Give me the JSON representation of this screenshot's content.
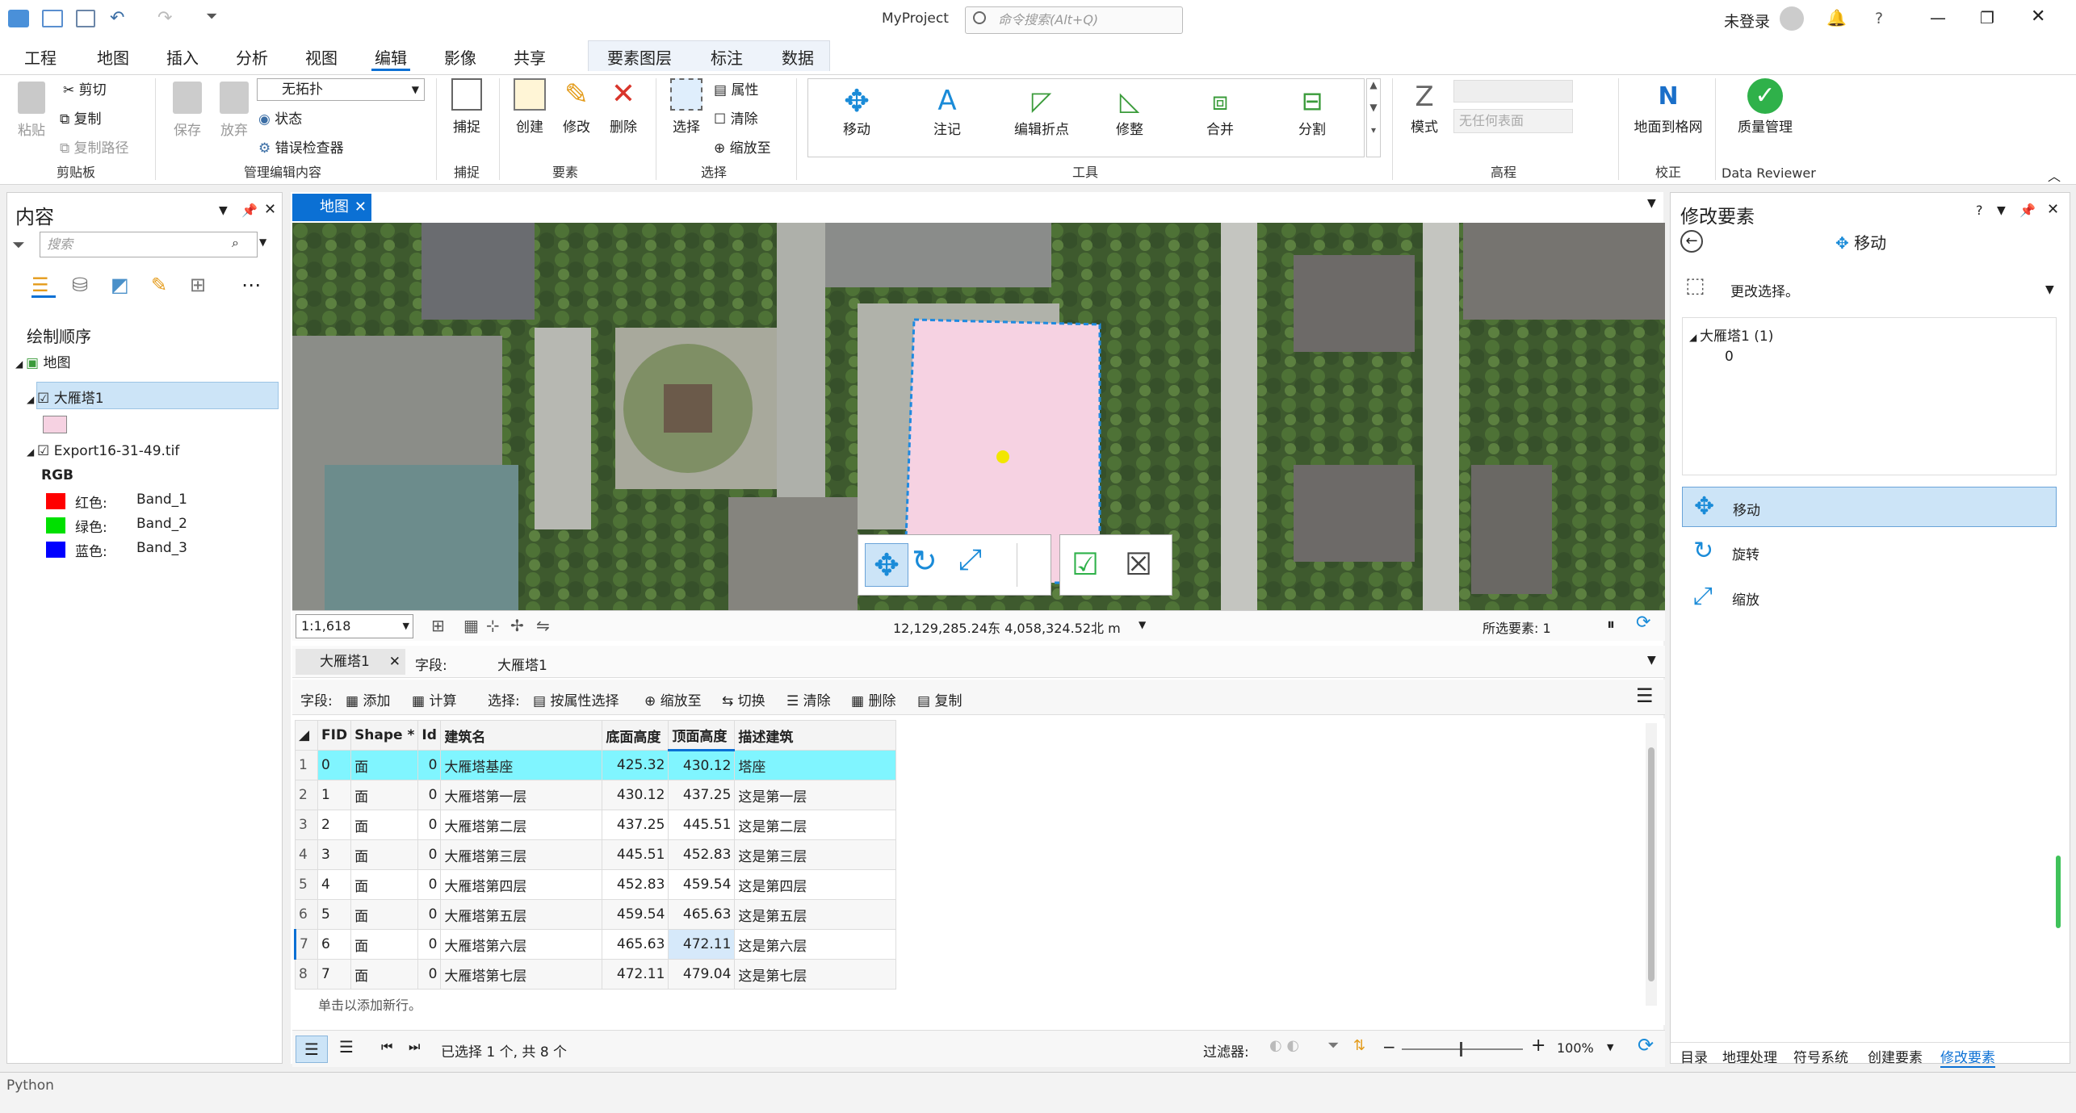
{
  "titlebar": {
    "title": "MyProject",
    "command_search_placeholder": "命令搜索(Alt+Q)",
    "sign_in": "未登录",
    "help": "?"
  },
  "tabs": [
    "工程",
    "地图",
    "插入",
    "分析",
    "视图",
    "编辑",
    "影像",
    "共享",
    "要素图层",
    "标注",
    "数据"
  ],
  "active_tab": "编辑",
  "ribbon": {
    "clipboard": {
      "paste": "粘贴",
      "cut": "剪切",
      "copy": "复制",
      "copy_path": "复制路径",
      "group": "剪贴板"
    },
    "manage": {
      "save": "保存",
      "discard": "放弃",
      "topology": "无拓扑",
      "status": "状态",
      "error_inspector": "错误检查器",
      "group": "管理编辑内容"
    },
    "snapping": {
      "snap": "捕捉",
      "group": "捕捉"
    },
    "features": {
      "create": "创建",
      "modify": "修改",
      "delete": "删除",
      "group": "要素"
    },
    "selection": {
      "select": "选择",
      "attributes": "属性",
      "clear": "清除",
      "zoom_to": "缩放至",
      "group": "选择"
    },
    "tools": {
      "move": "移动",
      "annotate": "注记",
      "edit_vertices": "编辑折点",
      "reshape": "修整",
      "merge": "合并",
      "split": "分割",
      "group": "工具"
    },
    "elevation": {
      "mode": "模式",
      "surface": "无任何表面",
      "group": "高程"
    },
    "correction": {
      "ground_to_grid": "地面到格网",
      "group": "校正"
    },
    "data_reviewer": {
      "quality": "质量管理",
      "group": "Data Reviewer"
    }
  },
  "contents": {
    "title": "内容",
    "search_placeholder": "搜索",
    "drawing_order": "绘制顺序",
    "map_name": "地图",
    "layer1": "大雁塔1",
    "layer2": "Export16-31-49.tif",
    "rgb": "RGB",
    "bands": [
      {
        "label": "红色:",
        "band": "Band_1",
        "color": "#ff0000"
      },
      {
        "label": "绿色:",
        "band": "Band_2",
        "color": "#00e000"
      },
      {
        "label": "蓝色:",
        "band": "Band_3",
        "color": "#0000ff"
      }
    ]
  },
  "map": {
    "tab_label": "地图",
    "scale": "1:1,618",
    "coords": "12,129,285.24东  4,058,324.52北 m",
    "selected_features": "所选要素: 1"
  },
  "table": {
    "tab_label": "大雁塔1",
    "fields_label": "字段:",
    "layer_name": "大雁塔1",
    "toolbar": {
      "fields": "字段:",
      "add": "添加",
      "calculate": "计算",
      "selection": "选择:",
      "select_by_attr": "按属性选择",
      "zoom_to": "缩放至",
      "switch": "切换",
      "clear": "清除",
      "delete": "删除",
      "copy": "复制"
    },
    "columns": [
      "FID",
      "Shape *",
      "Id",
      "建筑名",
      "底面高度",
      "顶面高度",
      "描述建筑"
    ],
    "rows": [
      {
        "n": "1",
        "fid": "0",
        "shape": "面",
        "id": "0",
        "name": "大雁塔基座",
        "bottom": "425.32",
        "top": "430.12",
        "desc": "塔座"
      },
      {
        "n": "2",
        "fid": "1",
        "shape": "面",
        "id": "0",
        "name": "大雁塔第一层",
        "bottom": "430.12",
        "top": "437.25",
        "desc": "这是第一层"
      },
      {
        "n": "3",
        "fid": "2",
        "shape": "面",
        "id": "0",
        "name": "大雁塔第二层",
        "bottom": "437.25",
        "top": "445.51",
        "desc": "这是第二层"
      },
      {
        "n": "4",
        "fid": "3",
        "shape": "面",
        "id": "0",
        "name": "大雁塔第三层",
        "bottom": "445.51",
        "top": "452.83",
        "desc": "这是第三层"
      },
      {
        "n": "5",
        "fid": "4",
        "shape": "面",
        "id": "0",
        "name": "大雁塔第四层",
        "bottom": "452.83",
        "top": "459.54",
        "desc": "这是第四层"
      },
      {
        "n": "6",
        "fid": "5",
        "shape": "面",
        "id": "0",
        "name": "大雁塔第五层",
        "bottom": "459.54",
        "top": "465.63",
        "desc": "这是第五层"
      },
      {
        "n": "7",
        "fid": "6",
        "shape": "面",
        "id": "0",
        "name": "大雁塔第六层",
        "bottom": "465.63",
        "top": "472.11",
        "desc": "这是第六层"
      },
      {
        "n": "8",
        "fid": "7",
        "shape": "面",
        "id": "0",
        "name": "大雁塔第七层",
        "bottom": "472.11",
        "top": "479.04",
        "desc": "这是第七层"
      }
    ],
    "add_row_hint": "单击以添加新行。",
    "selection_summary": "已选择 1 个, 共 8 个",
    "filter_label": "过滤器:",
    "zoom_pct": "100%"
  },
  "modify": {
    "title": "修改要素",
    "help": "?",
    "tool_name": "移动",
    "change_selection": "更改选择。",
    "tree_layer": "大雁塔1 (1)",
    "tree_item": "0",
    "options": [
      "移动",
      "旋转",
      "缩放"
    ],
    "bottom_tabs": [
      "目录",
      "地理处理",
      "符号系统",
      "创建要素",
      "修改要素"
    ]
  },
  "status": {
    "python": "Python"
  },
  "colors": {
    "accent": "#0b70d4",
    "selected_row": "#80f5ff",
    "polygon_fill": "#f6d2e2"
  }
}
